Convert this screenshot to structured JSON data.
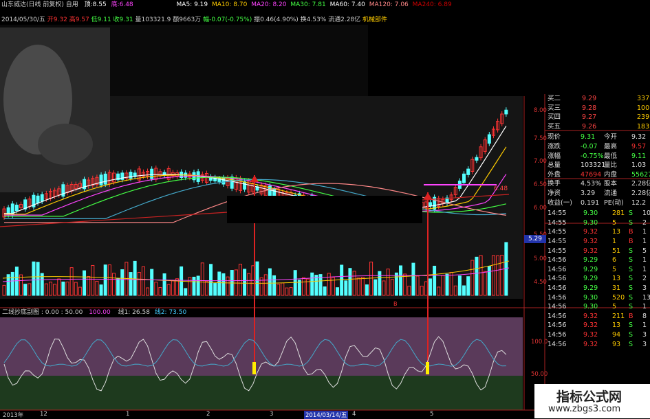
{
  "header": {
    "stock_name": "山东威达(日线 前复权) 自用",
    "h1": "顶:8.55",
    "h2": "底:6.48",
    "ma5": "MA5: 9.19",
    "ma10": "MA10: 8.70",
    "ma20": "MA20: 8.20",
    "ma30": "MA30: 7.81",
    "ma60": "MA60: 7.40",
    "ma120": "MA120: 7.06",
    "ma240": "MA240: 6.89",
    "date": "2014/05/30/五",
    "open": "开9.32",
    "high": "高9.57",
    "low": "低9.11",
    "close": "收9.31",
    "volume": "量103321.9",
    "amount": "额9663万",
    "change": "幅-0.07(-0.75%)",
    "amp": "振0.46(4.90%)",
    "turn": "换4.53%",
    "float": "流通2.28亿",
    "concept": "机械部件"
  },
  "price_axis": [
    "8.00",
    "7.50",
    "7.00",
    "6.50",
    "6.00",
    "5.50",
    "5.00",
    "4.50"
  ],
  "price_tag": "5.29",
  "bottom_label": "6.48",
  "indicator": {
    "title": "二线抄底副图 : 0.00 : 50.00",
    "v1": "100.00",
    "v2": "线1: 26.58",
    "v3": "线2: 73.50",
    "axis_top": "100.0",
    "axis_mid": "50.00",
    "marker": "B"
  },
  "x_axis": [
    "2013年",
    "12",
    "1",
    "2",
    "3",
    "2014/03/14/五",
    "4",
    "5"
  ],
  "order_book": [
    {
      "label": "买二",
      "price": "9.29",
      "vol": "337"
    },
    {
      "label": "买三",
      "price": "9.28",
      "vol": "100"
    },
    {
      "label": "买四",
      "price": "9.27",
      "vol": "239"
    },
    {
      "label": "买五",
      "price": "9.26",
      "vol": "183"
    }
  ],
  "stats": [
    {
      "l1": "现价",
      "v1": "9.31",
      "l2": "今开",
      "v2": "9.32"
    },
    {
      "l1": "涨跌",
      "v1": "-0.07",
      "l2": "最高",
      "v2": "9.57"
    },
    {
      "l1": "涨幅",
      "v1": "-0.75%",
      "l2": "最低",
      "v2": "9.11"
    },
    {
      "l1": "总量",
      "v1": "103321",
      "l2": "量比",
      "v2": "1.03"
    },
    {
      "l1": "外盘",
      "v1": "47694",
      "l2": "内盘",
      "v2": "55627"
    },
    {
      "l1": "换手",
      "v1": "4.53%",
      "l2": "股本",
      "v2": "2.28亿"
    },
    {
      "l1": "净资",
      "v1": "3.29",
      "l2": "流通",
      "v2": "2.28亿"
    },
    {
      "l1": "收益(一)",
      "v1": "0.191",
      "l2": "PE(动)",
      "v2": "12.2"
    }
  ],
  "ticks": [
    {
      "t": "14:55",
      "p": "9.30",
      "v": "281",
      "s": "S",
      "n": "10"
    },
    {
      "t": "14:55",
      "p": "9.30",
      "v": "5",
      "s": "S",
      "n": "2"
    },
    {
      "t": "14:55",
      "p": "9.32",
      "v": "13",
      "s": "B",
      "n": "1"
    },
    {
      "t": "14:55",
      "p": "9.32",
      "v": "1",
      "s": "B",
      "n": "1"
    },
    {
      "t": "14:55",
      "p": "9.32",
      "v": "51",
      "s": "S",
      "n": "5"
    },
    {
      "t": "14:56",
      "p": "9.29",
      "v": "6",
      "s": "S",
      "n": "1"
    },
    {
      "t": "14:56",
      "p": "9.29",
      "v": "5",
      "s": "S",
      "n": "1"
    },
    {
      "t": "14:56",
      "p": "9.29",
      "v": "13",
      "s": "S",
      "n": "2"
    },
    {
      "t": "14:56",
      "p": "9.29",
      "v": "31",
      "s": "S",
      "n": "3"
    },
    {
      "t": "14:56",
      "p": "9.30",
      "v": "520",
      "s": "S",
      "n": "13"
    },
    {
      "t": "14:56",
      "p": "9.30",
      "v": "5",
      "s": "S",
      "n": "1"
    },
    {
      "t": "14:56",
      "p": "9.32",
      "v": "211",
      "s": "B",
      "n": "8"
    },
    {
      "t": "14:56",
      "p": "9.32",
      "v": "13",
      "s": "S",
      "n": "1"
    },
    {
      "t": "14:56",
      "p": "9.32",
      "v": "94",
      "s": "S",
      "n": "3"
    },
    {
      "t": "14:56",
      "p": "9.32",
      "v": "93",
      "s": "S",
      "n": "3"
    }
  ],
  "watermark": {
    "title": "指标公式网",
    "url": "www.zbgs3.com"
  },
  "colors": {
    "up": "#ff3333",
    "down": "#54ffff",
    "ma5": "#ffffff",
    "ma10": "#ffcc00",
    "ma20": "#ff44ff",
    "ma30": "#44ff44"
  }
}
